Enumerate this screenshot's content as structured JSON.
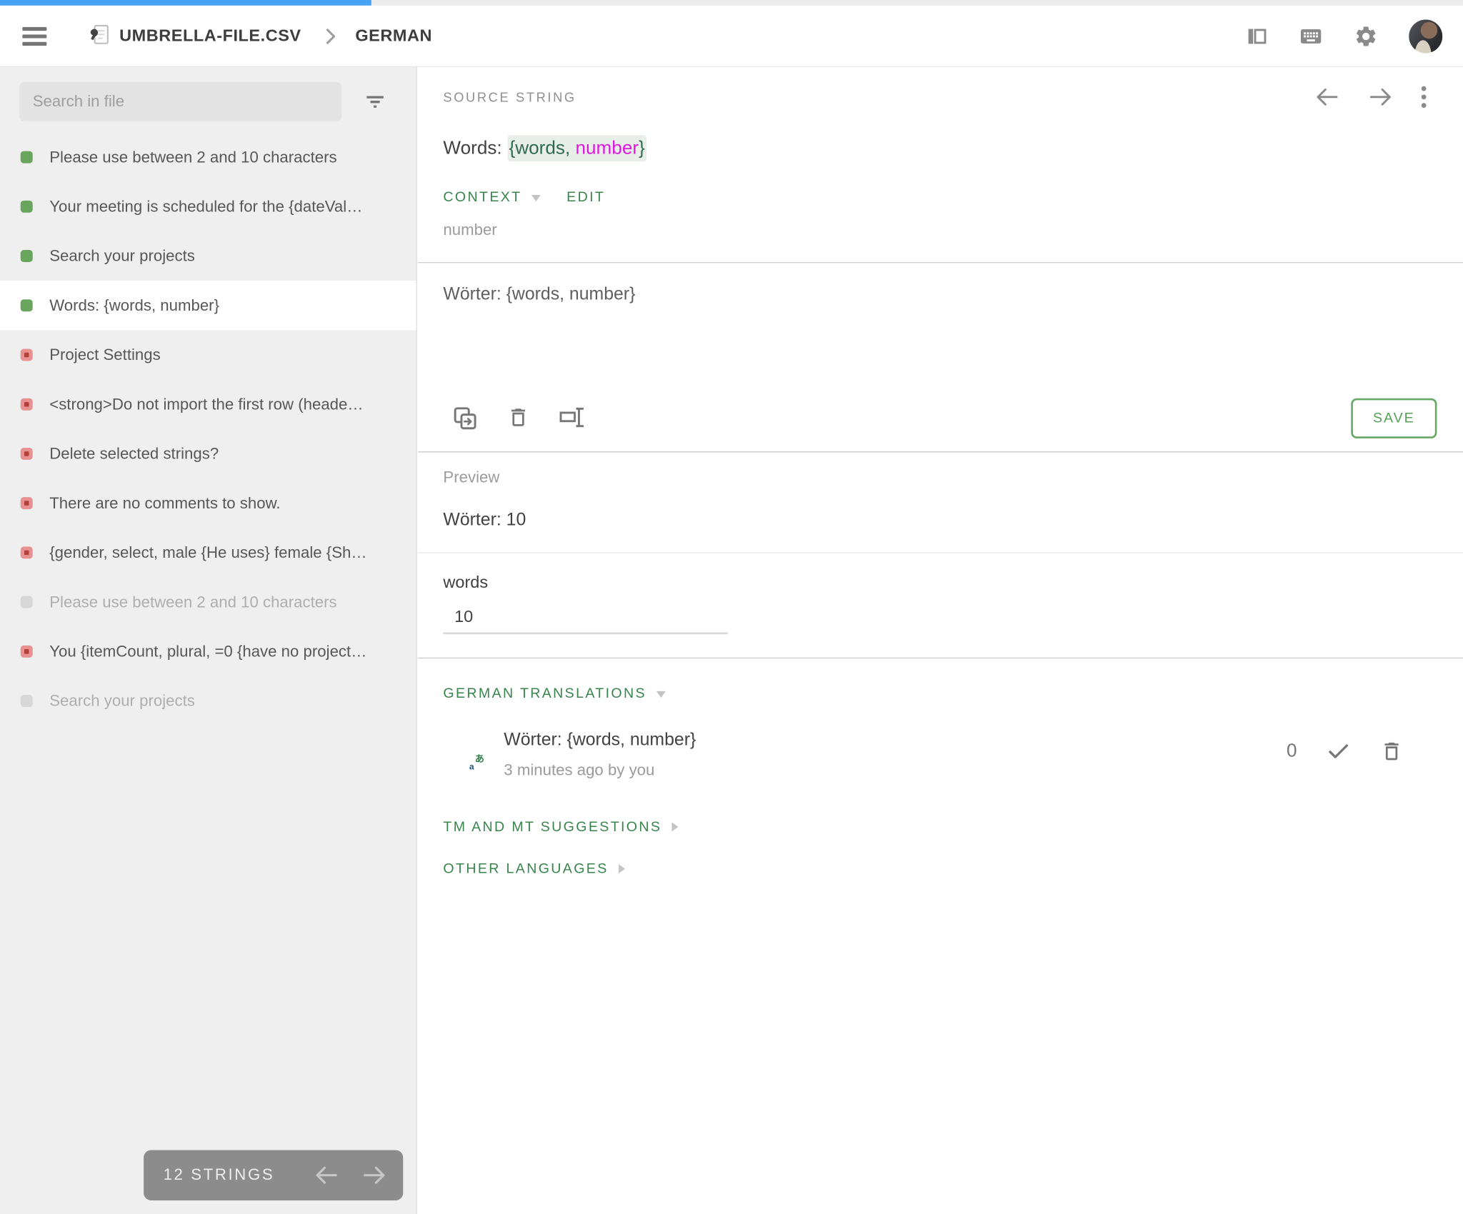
{
  "progress": {
    "translated_percent": 25.4
  },
  "topbar": {
    "file_name": "UMBRELLA-FILE.CSV",
    "language": "GERMAN"
  },
  "sidebar": {
    "search_placeholder": "Search in file",
    "items": [
      {
        "status": "green",
        "selected": false,
        "label": "Please use between 2 and 10 characters"
      },
      {
        "status": "green",
        "selected": false,
        "label": "Your meeting is scheduled for the {dateVal…"
      },
      {
        "status": "green",
        "selected": false,
        "label": "Search your projects"
      },
      {
        "status": "green",
        "selected": true,
        "label": "Words: {words, number}"
      },
      {
        "status": "red",
        "selected": false,
        "label": "Project Settings"
      },
      {
        "status": "red",
        "selected": false,
        "label": "<strong>Do not import the first row (heade…"
      },
      {
        "status": "red",
        "selected": false,
        "label": "Delete selected strings?"
      },
      {
        "status": "red",
        "selected": false,
        "label": "There are no comments to show."
      },
      {
        "status": "red",
        "selected": false,
        "label": "{gender, select, male {He uses} female {Sh…"
      },
      {
        "status": "gray",
        "selected": false,
        "label": "Please use between 2 and 10 characters"
      },
      {
        "status": "red",
        "selected": false,
        "label": "You {itemCount, plural, =0 {have no project…"
      },
      {
        "status": "gray",
        "selected": false,
        "label": "Search your projects"
      }
    ],
    "strings_count_label": "12 STRINGS"
  },
  "main": {
    "source": {
      "header": "SOURCE STRING",
      "text_prefix": "Words: ",
      "placeholder_open": "{words, ",
      "placeholder_param": "number",
      "placeholder_close": "}",
      "context_label": "CONTEXT",
      "edit_label": "EDIT",
      "context_value": "number"
    },
    "editor": {
      "translation_text": "Wörter: {words, number}",
      "save_label": "SAVE"
    },
    "preview": {
      "header": "Preview",
      "rendered_text": "Wörter: 10",
      "param_label": "words",
      "param_value": "10"
    },
    "translations": {
      "header": "GERMAN TRANSLATIONS",
      "entry": {
        "text": "Wörter: {words, number}",
        "meta": "3 minutes ago by you",
        "votes": "0"
      },
      "tm_suggestions_header": "TM AND MT SUGGESTIONS",
      "other_languages_header": "OTHER LANGUAGES"
    }
  },
  "colors": {
    "accent_green": "#38854C",
    "save_green": "#55A055",
    "placeholder_green": "#2E6B52",
    "placeholder_magenta": "#DF18DF",
    "progress_blue": "#47A3F3",
    "status_translated": "#6AA55E",
    "status_untranslated": "#E89191",
    "status_empty": "#D7D7D7"
  }
}
